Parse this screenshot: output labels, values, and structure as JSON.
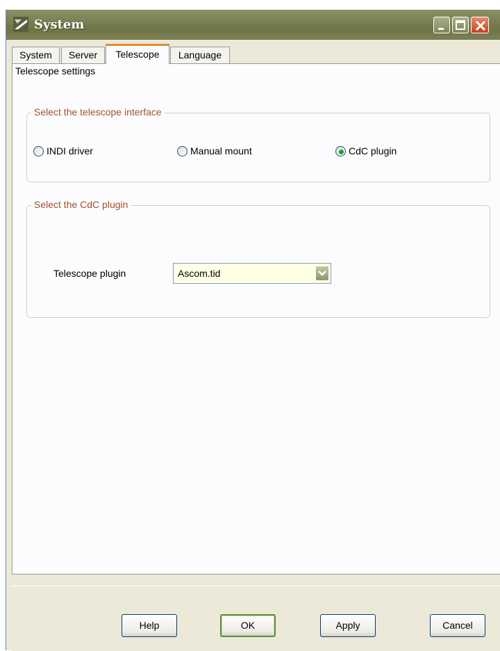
{
  "window": {
    "title": "System"
  },
  "tabs": [
    {
      "label": "System",
      "active": false
    },
    {
      "label": "Server",
      "active": false
    },
    {
      "label": "Telescope",
      "active": true
    },
    {
      "label": "Language",
      "active": false
    }
  ],
  "page": {
    "subtitle": "Telescope settings"
  },
  "interface_group": {
    "title": "Select the telescope interface",
    "options": [
      {
        "label": "INDI driver",
        "selected": false
      },
      {
        "label": "Manual mount",
        "selected": false
      },
      {
        "label": "CdC plugin",
        "selected": true
      }
    ]
  },
  "plugin_group": {
    "title": "Select the CdC plugin",
    "field_label": "Telescope plugin",
    "selected_value": "Ascom.tid"
  },
  "buttons": {
    "help": "Help",
    "ok": "OK",
    "apply": "Apply",
    "cancel": "Cancel"
  },
  "colors": {
    "titlebar": "#7d8256",
    "group_title": "#a0522d",
    "active_tab_accent": "#e68b2c",
    "radio_selected": "#21a121"
  },
  "icons": [
    "app-icon",
    "minimize-icon",
    "maximize-icon",
    "close-icon",
    "chevron-down-icon"
  ]
}
